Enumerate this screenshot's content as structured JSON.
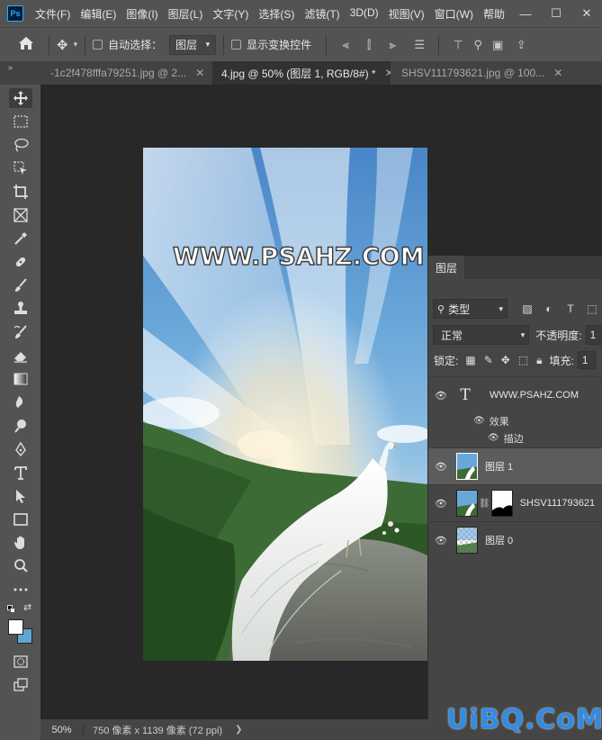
{
  "app": {
    "logo": "Ps",
    "icon": "photoshop-logo"
  },
  "menu": [
    "文件(F)",
    "编辑(E)",
    "图像(I)",
    "图层(L)",
    "文字(Y)",
    "选择(S)",
    "滤镜(T)",
    "3D(D)",
    "视图(V)",
    "窗口(W)",
    "帮助"
  ],
  "window_controls": {
    "minimize": "—",
    "maximize": "☐",
    "close": "✕"
  },
  "options": {
    "auto_select_label": "自动选择：",
    "auto_select_value": "图层",
    "show_transform_label": "显示变换控件"
  },
  "tabs": [
    {
      "label": "-1c2f478fffa79251.jpg @ 2...",
      "active": false
    },
    {
      "label": "4.jpg @ 50% (图层 1, RGB/8#) *",
      "active": true
    },
    {
      "label": "SHSV111793621.jpg @ 100...",
      "active": false
    }
  ],
  "canvas": {
    "overlay_text": "WWW.PSAHZ.COM"
  },
  "status": {
    "zoom": "50%",
    "info": "750 像素 x 1139 像素 (72 ppi)"
  },
  "layers_panel": {
    "title": "图层",
    "filter_kind": "类型",
    "blend_mode": "正常",
    "opacity_label": "不透明度:",
    "opacity_value": "1",
    "lock_label": "锁定:",
    "fill_label": "填充:",
    "fill_value": "1",
    "layers": [
      {
        "name": "WWW.PSAHZ.COM",
        "type": "text",
        "selected": false
      },
      {
        "name": "图层 1",
        "type": "image",
        "selected": true
      },
      {
        "name": "SHSV111793621",
        "type": "masked",
        "selected": false
      },
      {
        "name": "图层 0",
        "type": "transparent",
        "selected": false
      }
    ],
    "effects_label": "效果",
    "stroke_label": "描边"
  },
  "watermark": "UiBQ.CoM"
}
